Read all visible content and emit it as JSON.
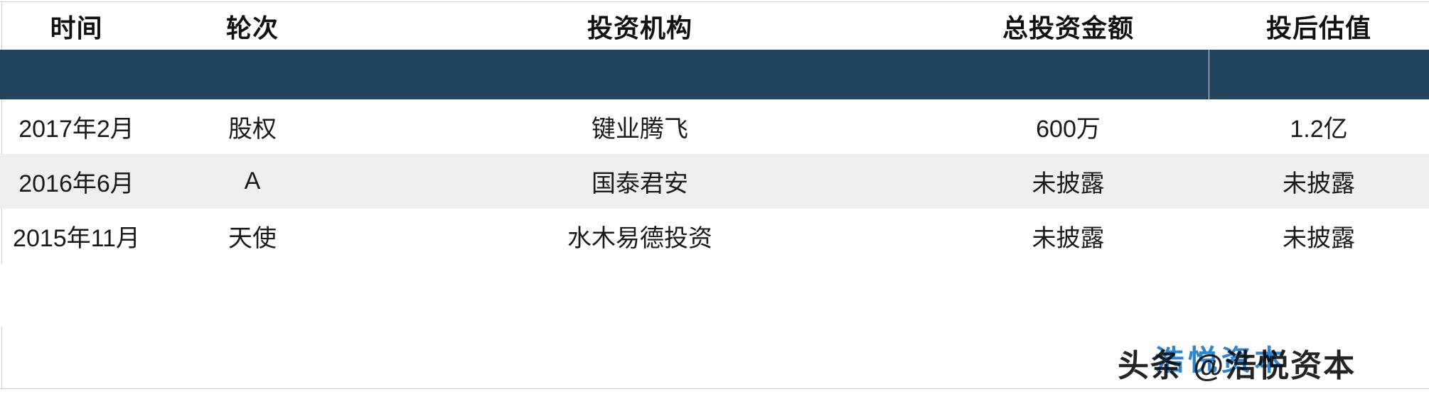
{
  "table": {
    "columns": [
      {
        "key": "time",
        "label": "时间"
      },
      {
        "key": "round",
        "label": "轮次"
      },
      {
        "key": "inst",
        "label": "投资机构"
      },
      {
        "key": "amount",
        "label": "总投资金额"
      },
      {
        "key": "value",
        "label": "投后估值"
      }
    ],
    "band": {
      "color": "#22455F",
      "divider_color": "#d6dde3"
    },
    "rows": [
      {
        "time": "2017年2月",
        "round": "股权",
        "inst": "键业腾飞",
        "amount": "600万",
        "value": "1.2亿"
      },
      {
        "time": "2016年6月",
        "round": "A",
        "inst": "国泰君安",
        "amount": "未披露",
        "value": "未披露"
      },
      {
        "time": "2015年11月",
        "round": "天使",
        "inst": "水木易德投资",
        "amount": "未披露",
        "value": "未披露"
      }
    ],
    "alt_row_color": "#efefef"
  },
  "watermark": {
    "dark_text": "头条 @浩悦资本",
    "blue_text": "浩悦资本",
    "dark_color": "#121212",
    "blue_color": "#1f7fd4"
  }
}
